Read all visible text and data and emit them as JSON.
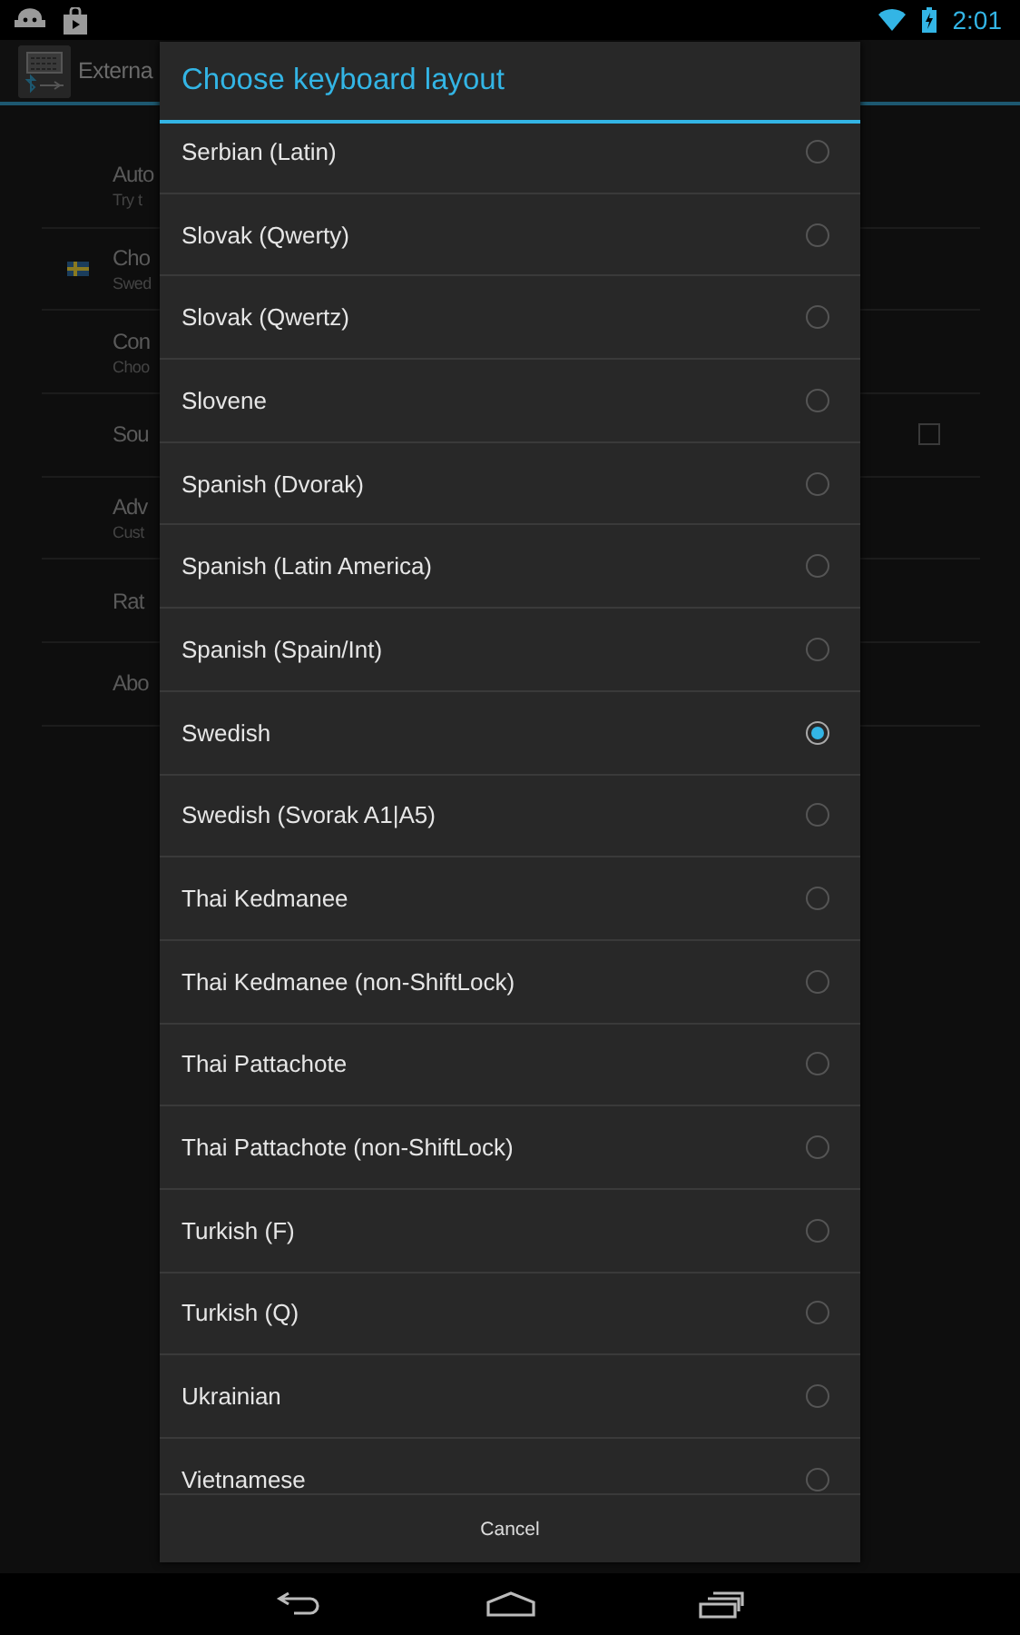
{
  "status_bar": {
    "time": "2:01"
  },
  "action_bar": {
    "title": "Externa"
  },
  "settings": [
    {
      "kind": "text",
      "title": "Auto",
      "summary": "Try t"
    },
    {
      "kind": "flag",
      "title": "Cho",
      "summary": "Swed"
    },
    {
      "kind": "text",
      "title": "Con",
      "summary": "Choo"
    },
    {
      "kind": "checkbox",
      "title": "Sou",
      "checked": false
    },
    {
      "kind": "text",
      "title": "Adv",
      "summary": "Cust"
    },
    {
      "kind": "text",
      "title": "Rat"
    },
    {
      "kind": "text",
      "title": "Abo"
    }
  ],
  "dialog": {
    "title": "Choose keyboard layout",
    "options": [
      {
        "label": "Serbian (Latin)",
        "selected": false
      },
      {
        "label": "Slovak (Qwerty)",
        "selected": false
      },
      {
        "label": "Slovak (Qwertz)",
        "selected": false
      },
      {
        "label": "Slovene",
        "selected": false
      },
      {
        "label": "Spanish (Dvorak)",
        "selected": false
      },
      {
        "label": "Spanish (Latin America)",
        "selected": false
      },
      {
        "label": "Spanish (Spain/Int)",
        "selected": false
      },
      {
        "label": "Swedish",
        "selected": true
      },
      {
        "label": "Swedish (Svorak A1|A5)",
        "selected": false
      },
      {
        "label": "Thai Kedmanee",
        "selected": false
      },
      {
        "label": "Thai Kedmanee (non-ShiftLock)",
        "selected": false
      },
      {
        "label": "Thai Pattachote",
        "selected": false
      },
      {
        "label": "Thai Pattachote (non-ShiftLock)",
        "selected": false
      },
      {
        "label": "Turkish (F)",
        "selected": false
      },
      {
        "label": "Turkish (Q)",
        "selected": false
      },
      {
        "label": "Ukrainian",
        "selected": false
      },
      {
        "label": "Vietnamese",
        "selected": false
      }
    ],
    "cancel": "Cancel"
  }
}
